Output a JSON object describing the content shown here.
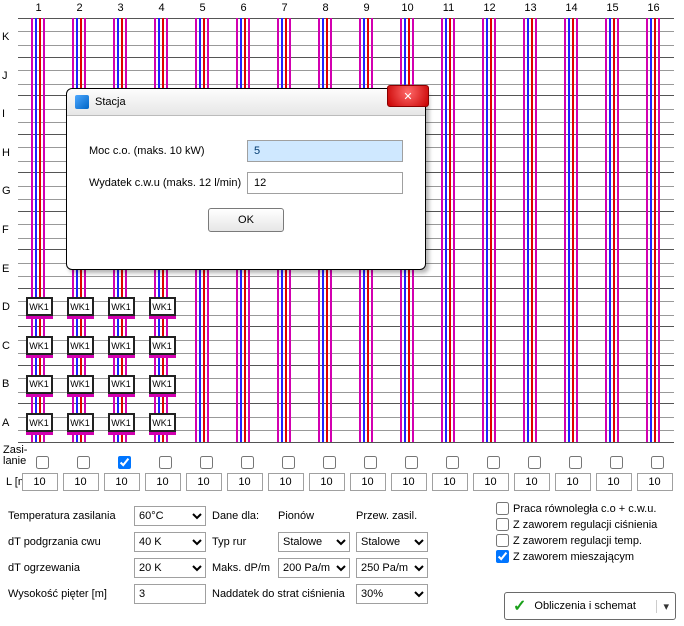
{
  "modal": {
    "title": "Stacja",
    "field_moc_label": "Moc c.o. (maks. 10 kW)",
    "field_moc_value": "5",
    "field_wyd_label": "Wydatek c.w.u (maks. 12 l/min)",
    "field_wyd_value": "12",
    "ok_label": "OK"
  },
  "grid": {
    "col_labels": [
      "1",
      "2",
      "3",
      "4",
      "5",
      "6",
      "7",
      "8",
      "9",
      "10",
      "11",
      "12",
      "13",
      "14",
      "15",
      "16"
    ],
    "row_labels": [
      "K",
      "J",
      "I",
      "H",
      "G",
      "F",
      "E",
      "D",
      "C",
      "B",
      "A"
    ],
    "wk_label": "WK1",
    "zasi_label": "Zasi-\nlanie",
    "zasi_checked_col": 2,
    "lm_label": "L [m]",
    "lm_values": [
      "10",
      "10",
      "10",
      "10",
      "10",
      "10",
      "10",
      "10",
      "10",
      "10",
      "10",
      "10",
      "10",
      "10",
      "10",
      "10"
    ]
  },
  "bottom": {
    "temp_zasilania_label": "Temperatura zasilania",
    "temp_zasilania_value": "60°C",
    "dt_podgrzania_label": "dT podgrzania cwu",
    "dt_podgrzania_value": "40 K",
    "dt_ogrzewania_label": "dT ogrzewania",
    "dt_ogrzewania_value": "20 K",
    "wysokosc_label": "Wysokość pięter [m]",
    "wysokosc_value": "3",
    "dane_dla_label": "Dane dla:",
    "pionow_label": "Pionów",
    "przew_label": "Przew. zasil.",
    "typ_rur_label": "Typ rur",
    "typ_rur_piony": "Stalowe",
    "typ_rur_przew": "Stalowe",
    "maks_dp_label": "Maks. dP/m",
    "maks_dp_piony": "200 Pa/m",
    "maks_dp_przew": "250 Pa/m",
    "naddatek_label": "Naddatek do strat ciśnienia",
    "naddatek_value": "30%",
    "cb_praca": "Praca równoległa c.o + c.w.u.",
    "cb_cisn": "Z zaworem regulacji ciśnienia",
    "cb_temp": "Z zaworem regulacji temp.",
    "cb_miesz": "Z zaworem mieszającym",
    "calc_label": "Obliczenia i schemat"
  }
}
